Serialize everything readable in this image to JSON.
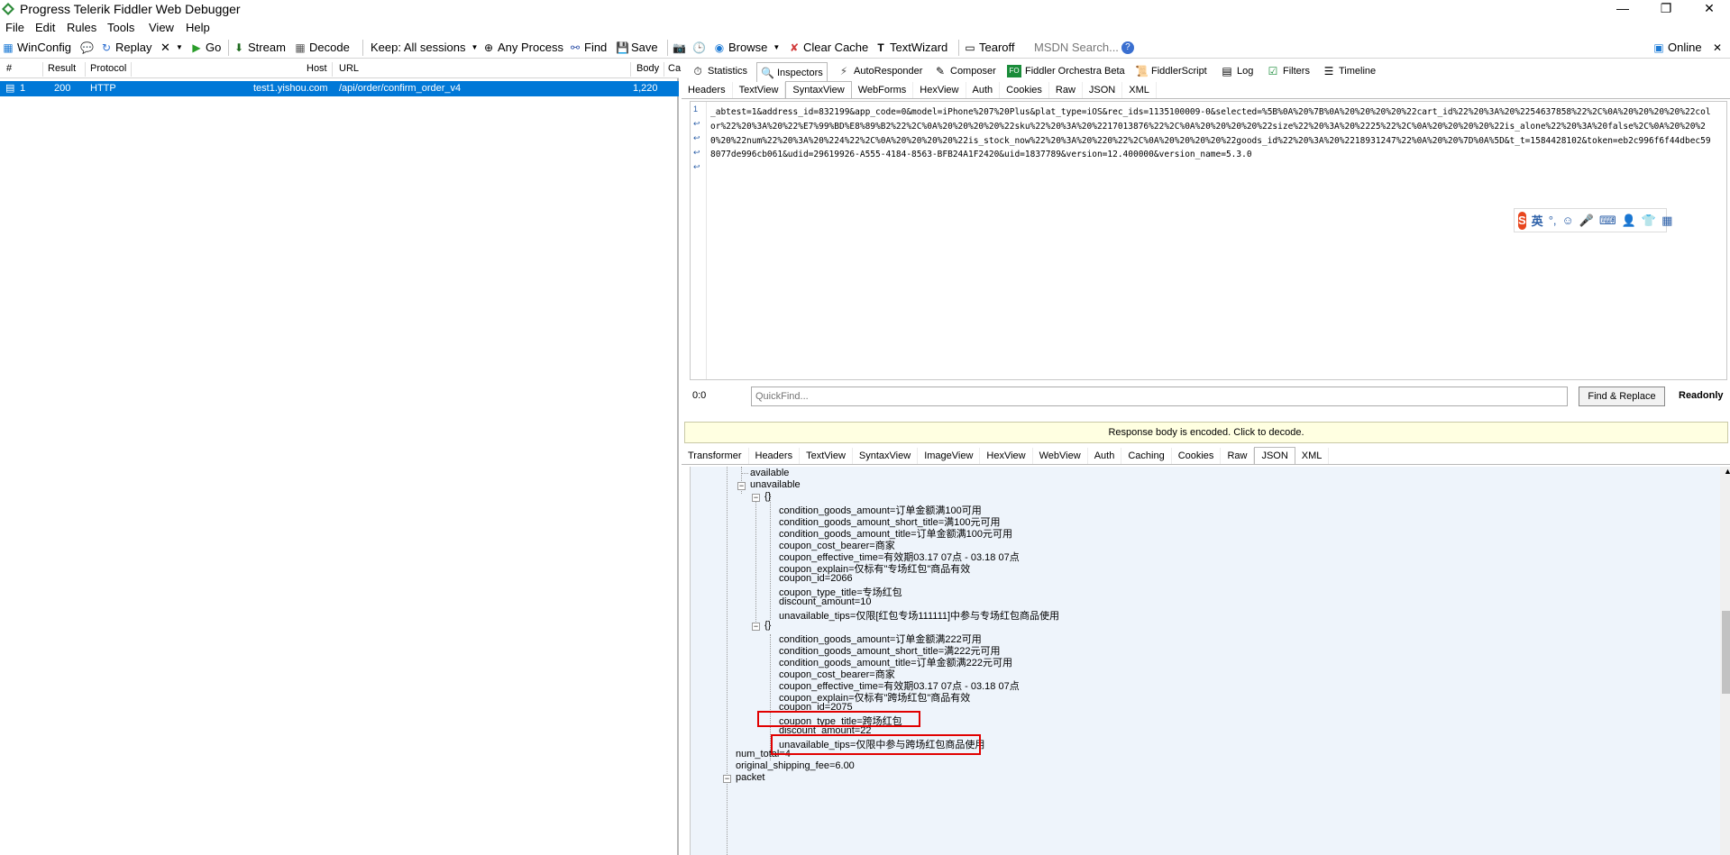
{
  "titlebar": {
    "title": "Progress Telerik Fiddler Web Debugger",
    "minimize": "—",
    "restore": "❐",
    "close": "✕"
  },
  "menu": [
    "File",
    "Edit",
    "Rules",
    "Tools",
    "View",
    "Help"
  ],
  "toolbar": {
    "winconfig": "WinConfig",
    "replay": "Replay",
    "remove": "✕",
    "go": "Go",
    "stream": "Stream",
    "decode": "Decode",
    "keep": "Keep: All sessions",
    "any_process": "Any Process",
    "find": "Find",
    "save": "Save",
    "browse": "Browse",
    "clear_cache": "Clear Cache",
    "textwizard": "TextWizard",
    "tearoff": "Tearoff",
    "msdn_search": "MSDN Search...",
    "online": "Online"
  },
  "sessions": {
    "columns": [
      "#",
      "Result",
      "Protocol",
      "Host",
      "URL",
      "Body",
      "Ca"
    ],
    "rows": [
      {
        "num": "1",
        "result": "200",
        "protocol": "HTTP",
        "host": "test1.yishou.com",
        "url": "/api/order/confirm_order_v4",
        "body": "1,220"
      }
    ]
  },
  "main_tabs": [
    "Statistics",
    "Inspectors",
    "AutoResponder",
    "Composer",
    "Fiddler Orchestra Beta",
    "FiddlerScript",
    "Log",
    "Filters",
    "Timeline"
  ],
  "fo_badge": "FO",
  "request_tabs": [
    "Headers",
    "TextView",
    "SyntaxView",
    "WebForms",
    "HexView",
    "Auth",
    "Cookies",
    "Raw",
    "JSON",
    "XML"
  ],
  "request_body": "_abtest=1&address_id=832199&app_code=0&model=iPhone%207%20Plus&plat_type=iOS&rec_ids=1135100009-0&selected=%5B%0A%20%7B%0A%20%20%20%20%22cart_id%22%20%3A%20%2254637858%22%2C%0A%20%20%20%20%22color%22%20%3A%20%22%E7%99%BD%E8%89%B2%22%2C%0A%20%20%20%20%22sku%22%20%3A%20%2217013876%22%2C%0A%20%20%20%20%22size%22%20%3A%20%2225%22%2C%0A%20%20%20%20%22is_alone%22%20%3A%20false%2C%0A%20%20%20%20%22num%22%20%3A%20%224%22%2C%0A%20%20%20%20%22is_stock_now%22%20%3A%20%220%22%2C%0A%20%20%20%20%22goods_id%22%20%3A%20%2218931247%22%0A%20%20%7D%0A%5D&t_t=1584428102&token=eb2c996f6f44dbec598077de996cb061&udid=29619926-A555-4184-8563-BFB24A1F2420&uid=1837789&version=12.400000&version_name=5.3.0",
  "line_number": "1",
  "ime": {
    "logo": "S",
    "lang": "英"
  },
  "findbar": {
    "position": "0:0",
    "placeholder": "QuickFind...",
    "button": "Find & Replace",
    "status": "Readonly"
  },
  "encoded_notice": "Response body is encoded. Click to decode.",
  "response_tabs": [
    "Transformer",
    "Headers",
    "TextView",
    "SyntaxView",
    "ImageView",
    "HexView",
    "WebView",
    "Auth",
    "Caching",
    "Cookies",
    "Raw",
    "JSON",
    "XML"
  ],
  "tree": {
    "available": "available",
    "unavailable": "unavailable",
    "obj": "{}",
    "item1": [
      "condition_goods_amount=订单金额满100可用",
      "condition_goods_amount_short_title=满100元可用",
      "condition_goods_amount_title=订单金额满100元可用",
      "coupon_cost_bearer=商家",
      "coupon_effective_time=有效期03.17 07点 - 03.18 07点",
      "coupon_explain=仅标有\"专场红包\"商品有效",
      "coupon_id=2066",
      "coupon_type_title=专场红包",
      "discount_amount=10",
      "unavailable_tips=仅限[红包专场111111]中参与专场红包商品使用"
    ],
    "item2": [
      "condition_goods_amount=订单金额满222可用",
      "condition_goods_amount_short_title=满222元可用",
      "condition_goods_amount_title=订单金额满222元可用",
      "coupon_cost_bearer=商家",
      "coupon_effective_time=有效期03.17 07点 - 03.18 07点",
      "coupon_explain=仅标有\"跨场红包\"商品有效",
      "coupon_id=2075",
      "coupon_type_title=跨场红包",
      "discount_amount=22",
      "unavailable_tips=仅限中参与跨场红包商品使用"
    ],
    "num_total": "num_total=4",
    "original_shipping_fee": "original_shipping_fee=6.00",
    "packet": "packet"
  },
  "colors": {
    "selection": "#0078d7",
    "tree_bg": "#eef4fb",
    "highlight": "#e10000",
    "notice_bg": "#ffffe1"
  }
}
